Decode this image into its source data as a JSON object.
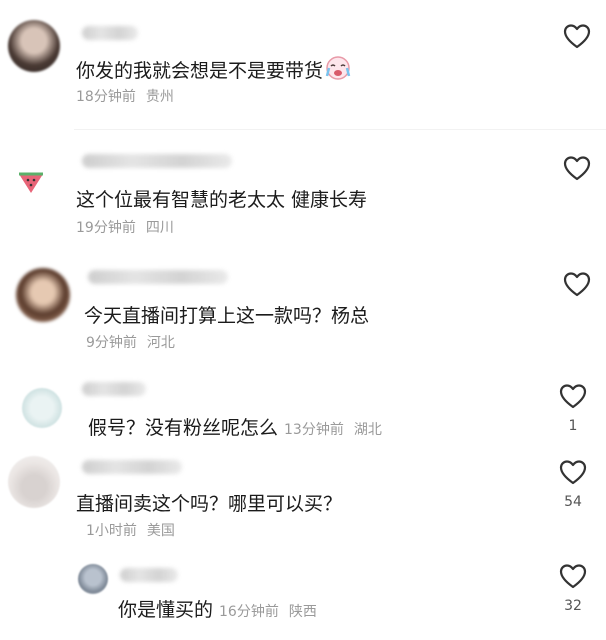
{
  "comments": [
    {
      "text": "你发的我就会想是不是要带货",
      "time": "18分钟前",
      "location": "贵州",
      "likes": ""
    },
    {
      "text": "这个位最有智慧的老太太  健康长寿",
      "time": "19分钟前",
      "location": "四川",
      "likes": ""
    },
    {
      "text": "今天直播间打算上这一款吗？杨总",
      "time": "9分钟前",
      "location": "河北",
      "likes": ""
    },
    {
      "text": "假号？没有粉丝呢怎么",
      "time": "13分钟前",
      "location": "湖北",
      "likes": "1"
    },
    {
      "text": "直播间卖这个吗？哪里可以买？",
      "time": "1小时前",
      "location": "美国",
      "likes": "54"
    },
    {
      "text": "你是懂买的",
      "time": "16分钟前",
      "location": "陕西",
      "likes": "32"
    }
  ],
  "icons": {
    "like": "heart-outline-icon",
    "emoji": "crying-face-emoji-icon"
  },
  "colors": {
    "text": "#1b1b1b",
    "meta": "#9a9a9a",
    "heart": "#333333"
  }
}
